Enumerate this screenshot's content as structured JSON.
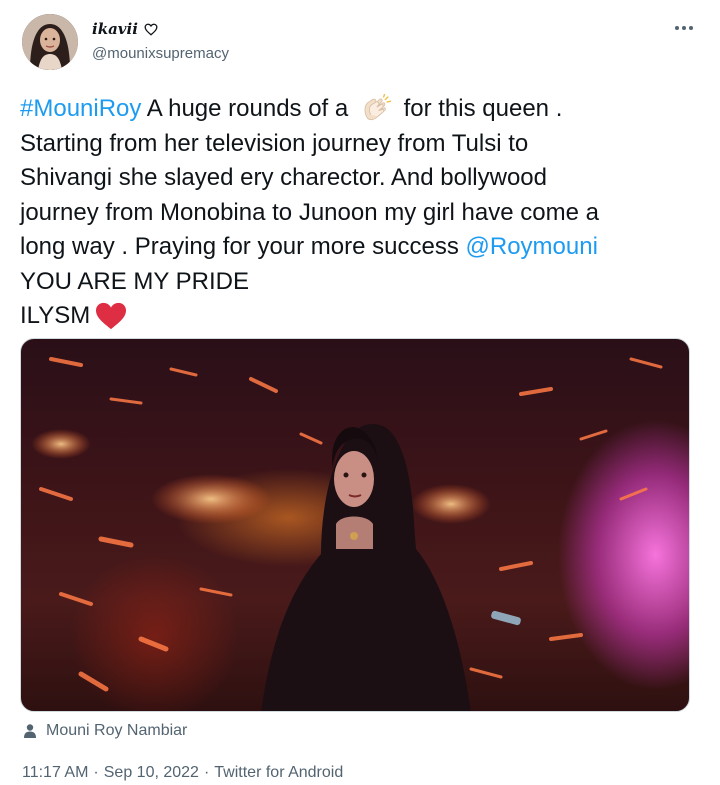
{
  "author": {
    "display_name": "ikavii",
    "handle": "@mounixsupremacy"
  },
  "tweet": {
    "line1": {
      "hashtag": "#MouniRoy",
      "before_emoji": " A huge rounds of a ",
      "after_emoji": " for this queen ."
    },
    "line2": "Starting from her television journey from Tulsi to",
    "line3": "Shivangi she slayed ery charector. And bollywood",
    "line4": "journey from Monobina to Junoon my girl have come a",
    "line5": {
      "text": "long way . Praying for your more success ",
      "mention": "@Roymouni"
    },
    "line6": "YOU ARE MY PRIDE",
    "line7": "ILYSM"
  },
  "media": {
    "tagged_user": "Mouni Roy Nambiar"
  },
  "meta": {
    "time": "11:17 AM",
    "separator": "·",
    "date": "Sep 10, 2022",
    "source": "Twitter for Android"
  },
  "icons": {
    "more": "more-options-icon",
    "clap": "clapping-hands-emoji",
    "heart": "red-heart-emoji",
    "name_badge": "heart-outline-icon",
    "tag": "person-icon"
  },
  "colors": {
    "link": "#1d9bf0",
    "muted": "#536471",
    "text": "#0f1419",
    "heart": "#e0245e"
  }
}
